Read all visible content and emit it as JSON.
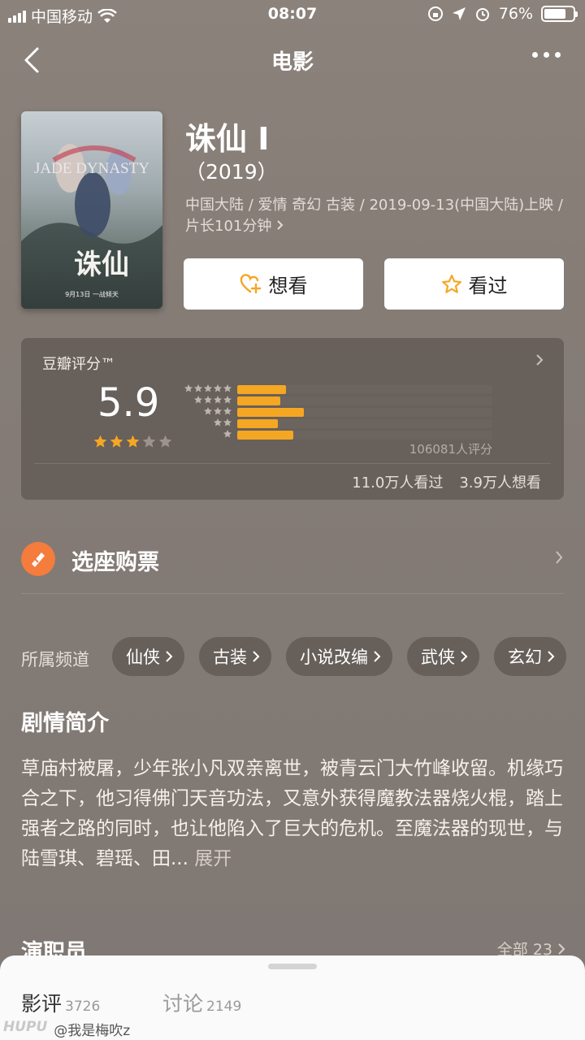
{
  "status": {
    "carrier": "中国移动",
    "time": "08:07",
    "battery": "76%",
    "battery_level": 0.76
  },
  "nav": {
    "title": "电影"
  },
  "movie": {
    "title": "诛仙 I",
    "year": "（2019）",
    "meta": "中国大陆 / 爱情 奇幻 古装 / 2019-09-13(中国大陆)上映 / 片长101分钟",
    "poster_title": "JADE DYNASTY",
    "poster_chinese": "诛仙",
    "poster_date": "9月13日 一战倾天"
  },
  "actions": {
    "want": "想看",
    "seen": "看过"
  },
  "rating": {
    "label": "豆瓣评分™",
    "score": "5.9",
    "stars_filled": 3,
    "distribution": [
      0.19,
      0.17,
      0.26,
      0.16,
      0.22
    ],
    "count": "106081人评分",
    "watched": "11.0万人看过",
    "want": "3.9万人想看"
  },
  "ticket": {
    "label": "选座购票"
  },
  "channels": {
    "label": "所属频道",
    "items": [
      "仙侠",
      "古装",
      "小说改编",
      "武侠",
      "玄幻"
    ]
  },
  "synopsis": {
    "title": "剧情简介",
    "text": "草庙村被屠，少年张小凡双亲离世，被青云门大竹峰收留。机缘巧合之下，他习得佛门天音功法，又意外获得魔教法器烧火棍，踏上强者之路的同时，也让他陷入了巨大的危机。至魔法器的现世，与陆雪琪、碧瑶、田...",
    "more": "展开"
  },
  "cast": {
    "title": "演职员",
    "all": "全部 23"
  },
  "sheet": {
    "tabs": [
      {
        "label": "影评",
        "count": "3726"
      },
      {
        "label": "讨论",
        "count": "2149"
      }
    ]
  },
  "watermark": {
    "brand": "HUPU",
    "user": "@我是梅吹z"
  },
  "colors": {
    "accent": "#f5a623",
    "ticket": "#f47c3c"
  }
}
